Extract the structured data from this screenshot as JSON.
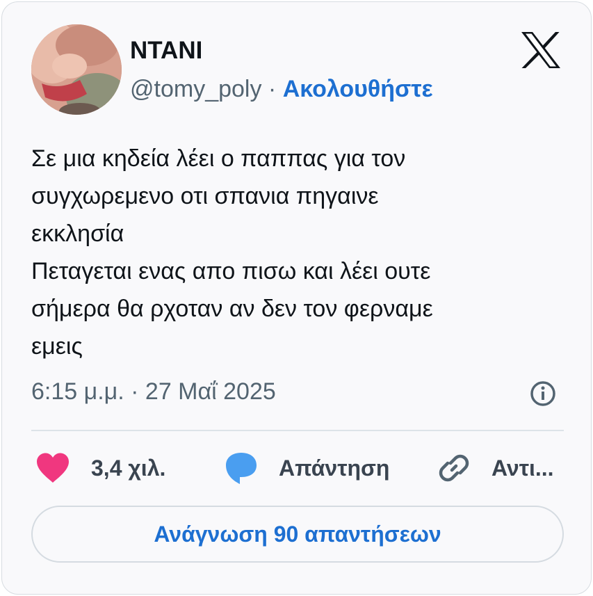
{
  "user": {
    "display_name": "NTANI",
    "handle": "@tomy_poly",
    "separator": " · ",
    "follow_label": "Ακολουθήστε"
  },
  "tweet": {
    "lines": [
      "Σε μια κηδεία λέει ο παππας για τον",
      "συγχωρεμενο οτι σπανια πηγαινε",
      "εκκλησία",
      "Πεταγεται ενας απο πισω και λέει ουτε",
      "σήμερα θα ρχοταν αν δεν τον φερναμε",
      "εμεις"
    ],
    "timestamp": "6:15 μ.μ. · 27 Μαΐ 2025"
  },
  "actions": {
    "like_count": "3,4 χιλ.",
    "reply_label": "Απάντηση",
    "copy_label": "Αντι..."
  },
  "read_replies_label": "Ανάγνωση 90 απαντήσεων",
  "icons": {
    "logo": "x-logo-icon",
    "info": "info-icon",
    "like": "heart-icon",
    "reply": "speech-bubble-icon",
    "copy": "link-icon"
  },
  "colors": {
    "accent": "#1d6fd1",
    "like": "#f0377f",
    "reply": "#4a9ef0",
    "text": "#0f1419",
    "muted": "#536471"
  }
}
